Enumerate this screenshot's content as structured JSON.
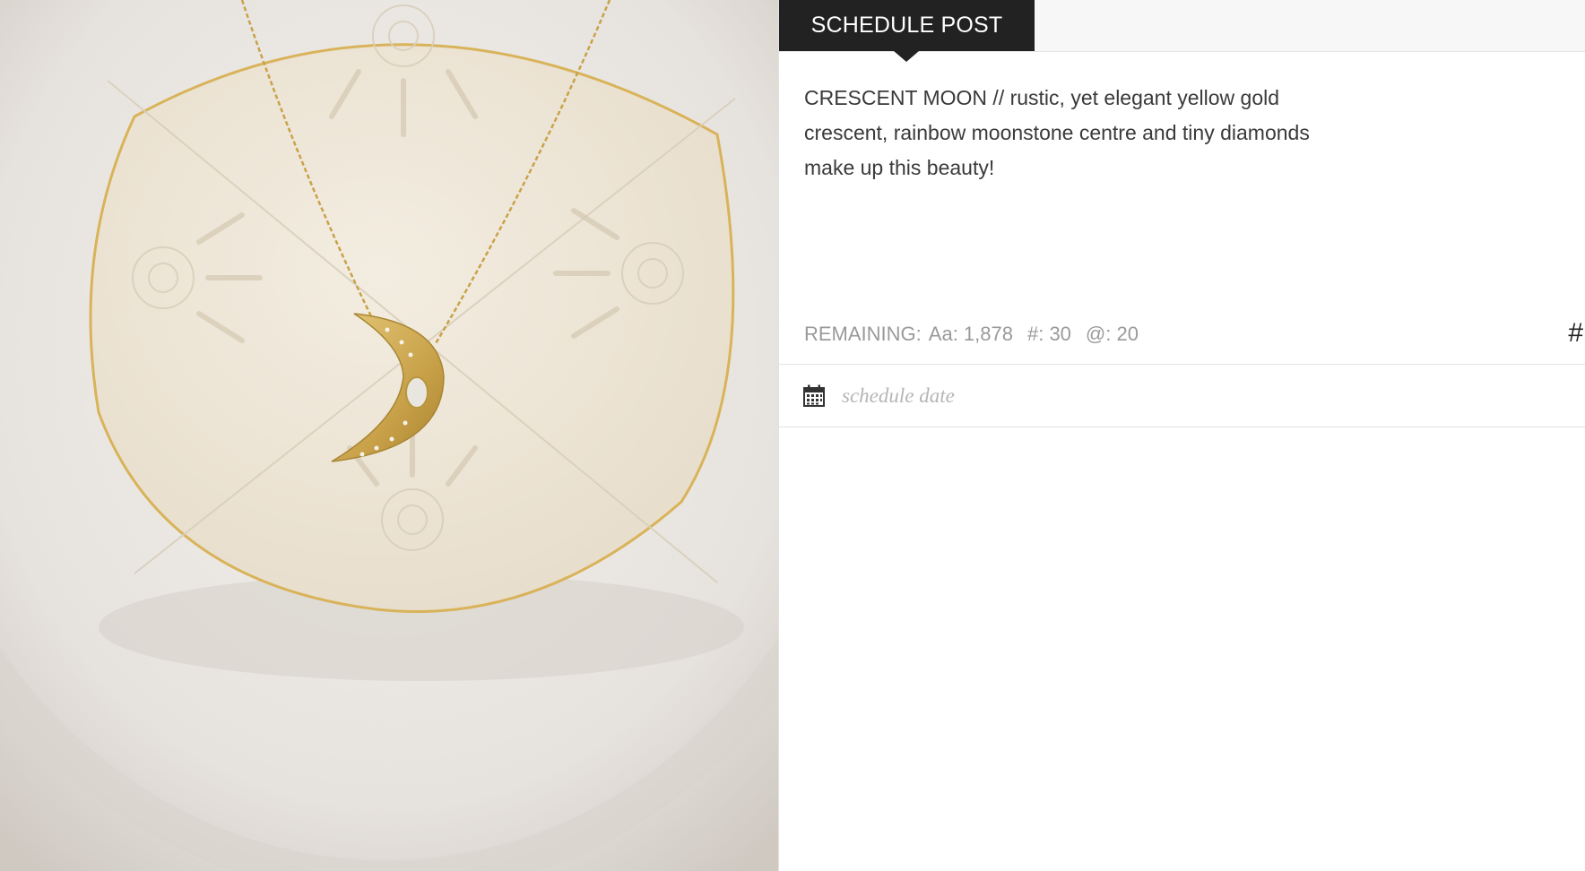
{
  "tabs": {
    "active_label": "SCHEDULE POST"
  },
  "post": {
    "caption": "CRESCENT MOON // rustic, yet elegant yellow gold crescent, rainbow moonstone centre and tiny diamonds make up this beauty!"
  },
  "counters": {
    "remaining_label": "REMAINING:",
    "chars": "Aa: 1,878",
    "hashtags": "#: 30",
    "mentions": "@: 20"
  },
  "hashtag_button": "#",
  "schedule": {
    "date_placeholder": "schedule date",
    "date_value": ""
  },
  "image": {
    "icon": "photo-necklace"
  },
  "colors": {
    "tab_bg": "#222222",
    "accent_gold": "#c9a24a"
  }
}
